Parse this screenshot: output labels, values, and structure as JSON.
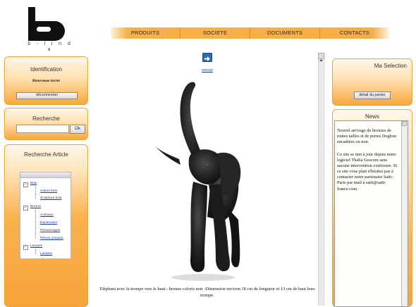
{
  "brand": {
    "logo_text": "b - l i n d a"
  },
  "nav": [
    {
      "label": "PRODUITS"
    },
    {
      "label": "SOCIETE"
    },
    {
      "label": "DOCUMENTS"
    },
    {
      "label": "CONTACTS"
    }
  ],
  "identification": {
    "title": "Identification",
    "welcome": "Bienvenue invité",
    "logout_label": "déconnexion"
  },
  "search": {
    "title": "Recherche",
    "value": "",
    "button_label": "Ok"
  },
  "article_search": {
    "title": "Recherche Article",
    "tree": [
      {
        "label": "Bois",
        "children": [
          {
            "label": "Autres bois"
          },
          {
            "label": "Sculpture bois"
          }
        ]
      },
      {
        "label": "Bronze",
        "children": [
          {
            "label": "Animaux"
          },
          {
            "label": "Danseuses"
          },
          {
            "label": "Personnages"
          },
          {
            "label": "Pièces uniques"
          }
        ]
      },
      {
        "label": "Lampes",
        "children": [
          {
            "label": "Lampes"
          }
        ]
      }
    ]
  },
  "product": {
    "back_label": "retour",
    "caption": "Eléphant avec la trompe vers le haut.- bronze coloris noir -Dimension environ 18 cm de longueur et 13 cm de haut hors trompe."
  },
  "selection": {
    "title": "Ma Selection",
    "button_label": "détail du panier"
  },
  "news": {
    "title": "News",
    "paragraph1": "Nouvel arrivage de bronzes de toutes tailles et de portes Doghon encadrées ou non.",
    "paragraph2": "Ce site se met à jour depuis notre logiciel Thalia Gescom sans aucune intervention extérieure. Si ce site vous plait n'hésitez pas à contacter notre partenaire Satti-Paris par mail à satti@satti-france.com."
  },
  "colors": {
    "accent": "#f7a83a",
    "link": "#1a3a9a"
  }
}
